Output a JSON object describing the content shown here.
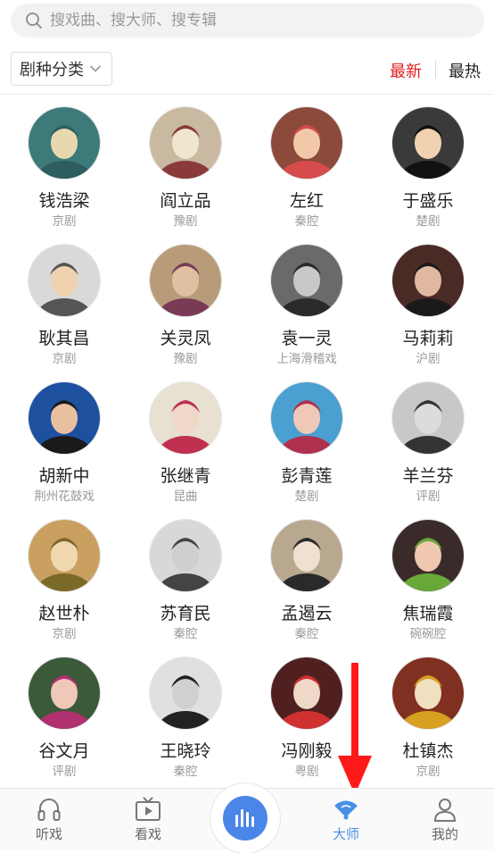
{
  "search": {
    "placeholder": "搜戏曲、搜大师、搜专辑"
  },
  "filter": {
    "genre_dropdown_label": "剧种分类",
    "sort_options": [
      "最新",
      "最热"
    ],
    "active_sort": "最新"
  },
  "masters": [
    {
      "name": "钱浩梁",
      "genre": "京剧"
    },
    {
      "name": "阎立品",
      "genre": "豫剧"
    },
    {
      "name": "左红",
      "genre": "秦腔"
    },
    {
      "name": "于盛乐",
      "genre": "楚剧"
    },
    {
      "name": "耿其昌",
      "genre": "京剧"
    },
    {
      "name": "关灵凤",
      "genre": "豫剧"
    },
    {
      "name": "袁一灵",
      "genre": "上海滑稽戏"
    },
    {
      "name": "马莉莉",
      "genre": "沪剧"
    },
    {
      "name": "胡新中",
      "genre": "荆州花鼓戏"
    },
    {
      "name": "张继青",
      "genre": "昆曲"
    },
    {
      "name": "彭青莲",
      "genre": "楚剧"
    },
    {
      "name": "羊兰芬",
      "genre": "评剧"
    },
    {
      "name": "赵世朴",
      "genre": "京剧"
    },
    {
      "name": "苏育民",
      "genre": "秦腔"
    },
    {
      "name": "孟遏云",
      "genre": "秦腔"
    },
    {
      "name": "焦瑞霞",
      "genre": "碗碗腔"
    },
    {
      "name": "谷文月",
      "genre": "评剧"
    },
    {
      "name": "王晓玲",
      "genre": "秦腔"
    },
    {
      "name": "冯刚毅",
      "genre": "粤剧"
    },
    {
      "name": "杜镇杰",
      "genre": "京剧"
    }
  ],
  "tabbar": {
    "tabs": [
      {
        "label": "听戏",
        "icon": "headphones-icon"
      },
      {
        "label": "看戏",
        "icon": "tv-icon"
      },
      {
        "label": "大师",
        "icon": "fan-icon"
      },
      {
        "label": "我的",
        "icon": "user-icon"
      }
    ],
    "active_tab": "大师",
    "center_icon": "equalizer-icon"
  },
  "colors": {
    "accent_red": "#e02020",
    "tab_active": "#4a8fe6",
    "center_button": "#4a86e8",
    "annotation_arrow": "#ff1a1a"
  }
}
